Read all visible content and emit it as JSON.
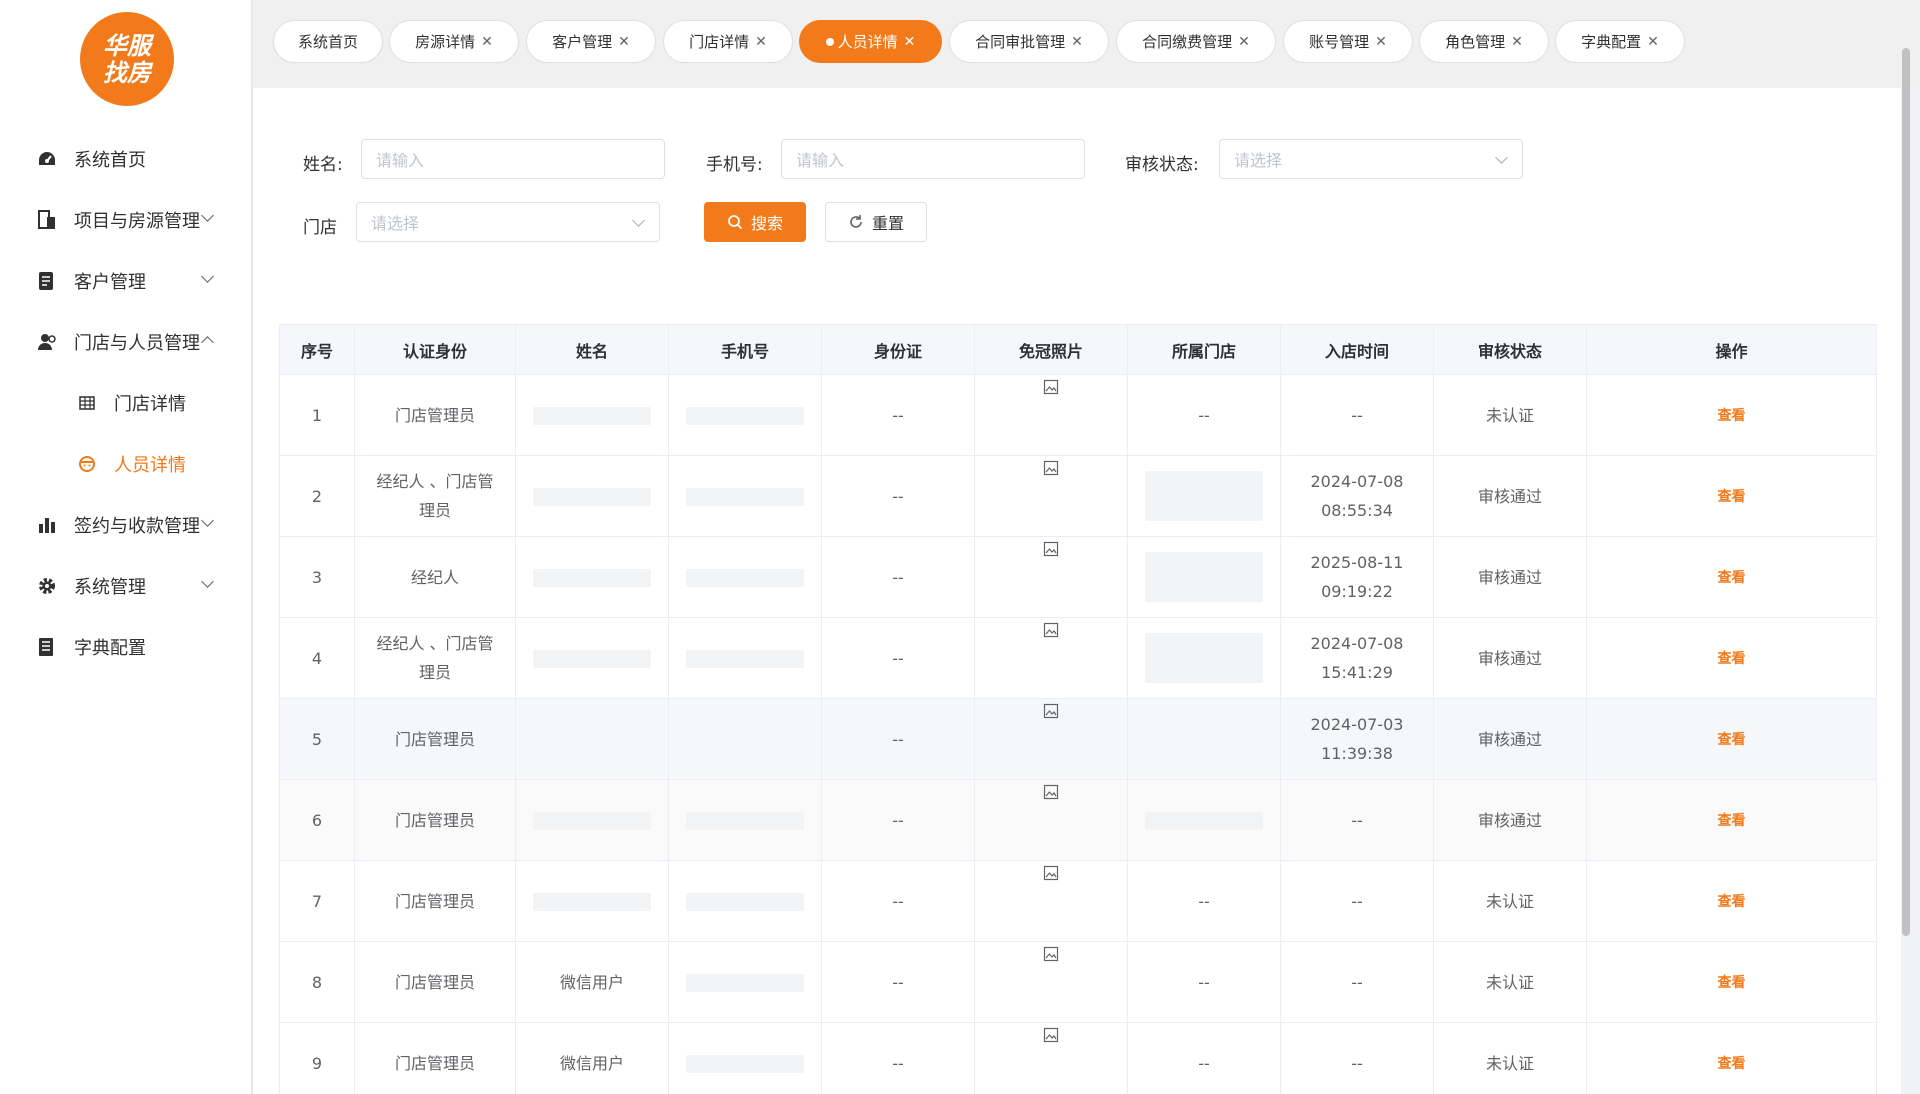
{
  "logo": {
    "line1": "华服",
    "line2": "找房"
  },
  "sidebar": {
    "items": [
      {
        "label": "系统首页",
        "icon": "dashboard-icon",
        "arrow": ""
      },
      {
        "label": "项目与房源管理",
        "icon": "building-icon",
        "arrow": "down"
      },
      {
        "label": "客户管理",
        "icon": "customer-icon",
        "arrow": "down"
      },
      {
        "label": "门店与人员管理",
        "icon": "user-icon",
        "arrow": "up"
      },
      {
        "label": "门店详情",
        "icon": "grid-icon",
        "arrow": ""
      },
      {
        "label": "人员详情",
        "icon": "staff-icon",
        "arrow": ""
      },
      {
        "label": "签约与收款管理",
        "icon": "chart-icon",
        "arrow": "down"
      },
      {
        "label": "系统管理",
        "icon": "gear-icon",
        "arrow": "down"
      },
      {
        "label": "字典配置",
        "icon": "dictionary-icon",
        "arrow": ""
      }
    ]
  },
  "tabs": [
    {
      "label": "系统首页"
    },
    {
      "label": "房源详情"
    },
    {
      "label": "客户管理"
    },
    {
      "label": "门店详情"
    },
    {
      "label": "人员详情"
    },
    {
      "label": "合同审批管理"
    },
    {
      "label": "合同缴费管理"
    },
    {
      "label": "账号管理"
    },
    {
      "label": "角色管理"
    },
    {
      "label": "字典配置"
    }
  ],
  "filters": {
    "name_label": "姓名:",
    "name_placeholder": "请输入",
    "phone_label": "手机号:",
    "phone_placeholder": "请输入",
    "status_label": "审核状态:",
    "status_placeholder": "请选择",
    "store_label": "门店",
    "store_placeholder": "请选择",
    "search_label": "搜索",
    "reset_label": "重置"
  },
  "table": {
    "columns": [
      "序号",
      "认证身份",
      "姓名",
      "手机号",
      "身份证",
      "免冠照片",
      "所属门店",
      "入店时间",
      "审核状态",
      "操作"
    ],
    "rows": [
      {
        "no": "1",
        "role": "门店管理员",
        "id_card": "--",
        "store": "--",
        "time": "--",
        "status": "未认证",
        "action": "查看"
      },
      {
        "no": "2",
        "role": "经纪人 、门店管理员",
        "id_card": "--",
        "store": "",
        "time": "2024-07-08 08:55:34",
        "status": "审核通过",
        "action": "查看"
      },
      {
        "no": "3",
        "role": "经纪人",
        "id_card": "--",
        "store": "",
        "time": "2025-08-11 09:19:22",
        "status": "审核通过",
        "action": "查看"
      },
      {
        "no": "4",
        "role": "经纪人 、门店管理员",
        "id_card": "--",
        "store": "",
        "time": "2024-07-08 15:41:29",
        "status": "审核通过",
        "action": "查看"
      },
      {
        "no": "5",
        "role": "门店管理员",
        "id_card": "--",
        "store": "",
        "time": "2024-07-03 11:39:38",
        "status": "审核通过",
        "action": "查看"
      },
      {
        "no": "6",
        "role": "门店管理员",
        "id_card": "--",
        "store": "",
        "time": "--",
        "status": "审核通过",
        "action": "查看"
      },
      {
        "no": "7",
        "role": "门店管理员",
        "id_card": "--",
        "store": "--",
        "time": "--",
        "status": "未认证",
        "action": "查看"
      },
      {
        "no": "8",
        "role": "门店管理员",
        "name": "微信用户",
        "id_card": "--",
        "store": "--",
        "time": "--",
        "status": "未认证",
        "action": "查看"
      },
      {
        "no": "9",
        "role": "门店管理员",
        "name": "微信用户",
        "id_card": "--",
        "store": "--",
        "time": "--",
        "status": "未认证",
        "action": "查看"
      }
    ]
  },
  "colors": {
    "accent": "#f27a1a"
  }
}
